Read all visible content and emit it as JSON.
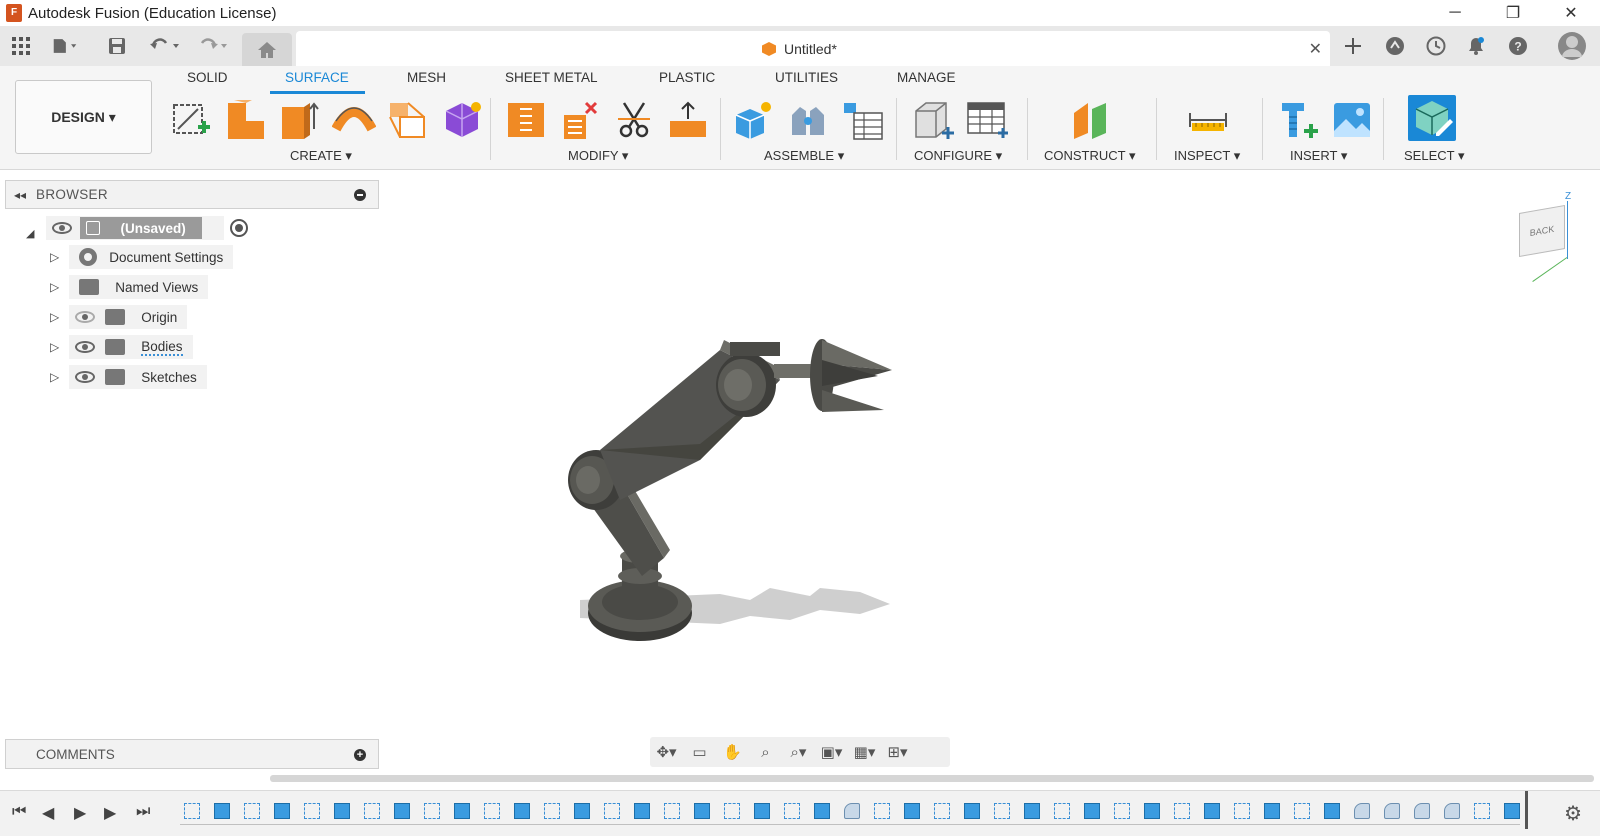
{
  "window": {
    "title": "Autodesk Fusion (Education License)",
    "logo_letter": "F",
    "minimize": "─",
    "restore": "❐",
    "close": "✕"
  },
  "document_tab": {
    "name": "Untitled*",
    "close": "✕"
  },
  "workspace": {
    "label": "DESIGN ▾"
  },
  "ribbon_tabs": [
    {
      "label": "SOLID",
      "active": false
    },
    {
      "label": "SURFACE",
      "active": true
    },
    {
      "label": "MESH",
      "active": false
    },
    {
      "label": "SHEET METAL",
      "active": false
    },
    {
      "label": "PLASTIC",
      "active": false
    },
    {
      "label": "UTILITIES",
      "active": false
    },
    {
      "label": "MANAGE",
      "active": false
    }
  ],
  "ribbon_groups": [
    {
      "label": "CREATE ▾"
    },
    {
      "label": "MODIFY ▾"
    },
    {
      "label": "ASSEMBLE ▾"
    },
    {
      "label": "CONFIGURE ▾"
    },
    {
      "label": "CONSTRUCT ▾"
    },
    {
      "label": "INSPECT ▾"
    },
    {
      "label": "INSERT ▾"
    },
    {
      "label": "SELECT ▾"
    }
  ],
  "browser": {
    "title": "BROWSER",
    "root": "(Unsaved)",
    "items": [
      {
        "label": "Document Settings",
        "icon": "gear-icon"
      },
      {
        "label": "Named Views",
        "icon": "folder-icon"
      },
      {
        "label": "Origin",
        "icon": "folder-icon",
        "hidden": true
      },
      {
        "label": "Bodies",
        "icon": "folder-icon"
      },
      {
        "label": "Sketches",
        "icon": "folder-icon"
      }
    ]
  },
  "comments": {
    "title": "COMMENTS"
  },
  "viewcube": {
    "face": "BACK",
    "axis": "Z"
  },
  "colors": {
    "accent": "#1a88d6",
    "model": "#4a4a46",
    "tab_active": "#1a88d6",
    "orange": "#f08a24"
  }
}
